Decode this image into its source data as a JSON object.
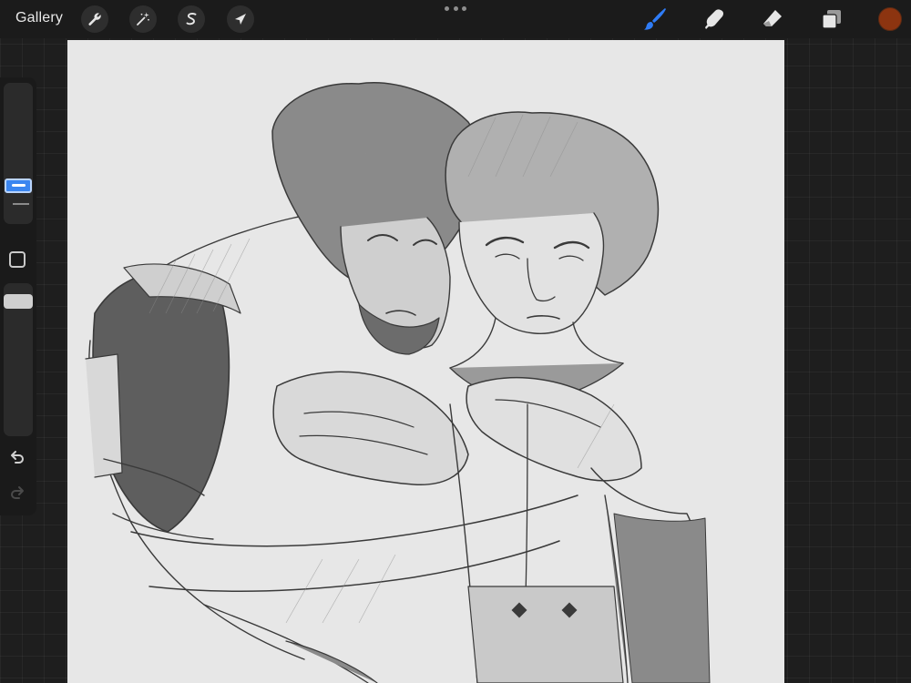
{
  "toolbar": {
    "gallery_label": "Gallery",
    "left_tools": [
      {
        "name": "actions",
        "icon": "wrench-icon"
      },
      {
        "name": "adjustments",
        "icon": "magic-wand-icon"
      },
      {
        "name": "selection",
        "icon": "selection-s-icon"
      },
      {
        "name": "transform",
        "icon": "arrow-cursor-icon"
      }
    ],
    "more_icon": "ellipsis-icon",
    "right_tools": [
      {
        "name": "brush",
        "icon": "brush-icon",
        "active": true
      },
      {
        "name": "smudge",
        "icon": "smudge-finger-icon",
        "active": false
      },
      {
        "name": "eraser",
        "icon": "eraser-icon",
        "active": false
      },
      {
        "name": "layers",
        "icon": "layers-icon",
        "active": false
      }
    ],
    "current_color": "#8c3410",
    "accent_color": "#2f7cf6"
  },
  "sidebar": {
    "brush_size_slider": {
      "level": 0.7
    },
    "modify_icon": "square-modify-icon",
    "opacity_slider": {
      "level": 0.95
    },
    "undo_icon": "undo-icon",
    "redo_icon": "redo-icon",
    "redo_enabled": false
  },
  "canvas": {
    "background_color": "#e7e7e7",
    "content": "pencil-sketch-artwork"
  }
}
